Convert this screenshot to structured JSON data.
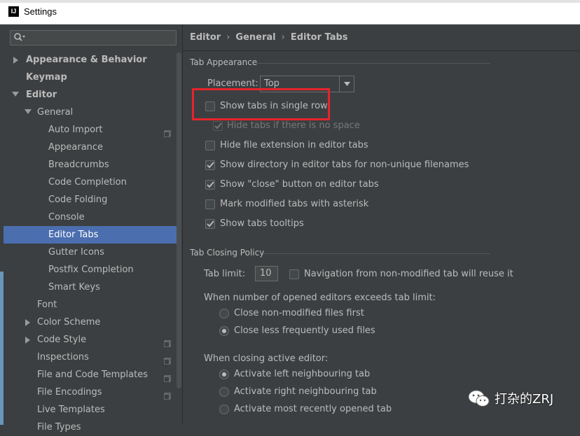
{
  "window": {
    "title": "Settings",
    "logo": "IJ"
  },
  "search": {
    "placeholder": ""
  },
  "tree": {
    "items": [
      {
        "label": "Appearance & Behavior",
        "bold": true
      },
      {
        "label": "Keymap",
        "bold": true
      },
      {
        "label": "Editor",
        "bold": true
      },
      {
        "label": "General"
      },
      {
        "label": "Auto Import"
      },
      {
        "label": "Appearance"
      },
      {
        "label": "Breadcrumbs"
      },
      {
        "label": "Code Completion"
      },
      {
        "label": "Code Folding"
      },
      {
        "label": "Console"
      },
      {
        "label": "Editor Tabs",
        "selected": true
      },
      {
        "label": "Gutter Icons"
      },
      {
        "label": "Postfix Completion"
      },
      {
        "label": "Smart Keys"
      },
      {
        "label": "Font"
      },
      {
        "label": "Color Scheme"
      },
      {
        "label": "Code Style"
      },
      {
        "label": "Inspections"
      },
      {
        "label": "File and Code Templates"
      },
      {
        "label": "File Encodings"
      },
      {
        "label": "Live Templates"
      },
      {
        "label": "File Types"
      }
    ]
  },
  "breadcrumb": {
    "items": [
      "Editor",
      "General",
      "Editor Tabs"
    ],
    "separator": "›"
  },
  "tab_appearance": {
    "title": "Tab Appearance",
    "placement_label": "Placement:",
    "placement_value": "Top",
    "options": [
      {
        "label": "Show tabs in single row",
        "checked": false
      },
      {
        "label": "Hide tabs if there is no space",
        "checked": true,
        "disabled": true
      },
      {
        "label": "Hide file extension in editor tabs",
        "checked": false
      },
      {
        "label": "Show directory in editor tabs for non-unique filenames",
        "checked": true
      },
      {
        "label": "Show \"close\" button on editor tabs",
        "checked": true
      },
      {
        "label": "Mark modified tabs with asterisk",
        "checked": false
      },
      {
        "label": "Show tabs tooltips",
        "checked": true
      }
    ]
  },
  "tab_closing": {
    "title": "Tab Closing Policy",
    "tab_limit_label": "Tab limit:",
    "tab_limit_value": "10",
    "nav_option": {
      "label": "Navigation from non-modified tab will reuse it",
      "checked": false
    },
    "exceeds_label": "When number of opened editors exceeds tab limit:",
    "exceeds_options": [
      {
        "label": "Close non-modified files first",
        "selected": false
      },
      {
        "label": "Close less frequently used files",
        "selected": true
      }
    ],
    "closing_label": "When closing active editor:",
    "closing_options": [
      {
        "label": "Activate left neighbouring tab",
        "selected": true
      },
      {
        "label": "Activate right neighbouring tab",
        "selected": false
      },
      {
        "label": "Activate most recently opened tab",
        "selected": false
      }
    ]
  },
  "watermark": {
    "text": "打杂的ZRJ"
  },
  "colors": {
    "selection": "#4b6eaf",
    "background": "#3c3f41",
    "highlight": "#e6242b"
  }
}
